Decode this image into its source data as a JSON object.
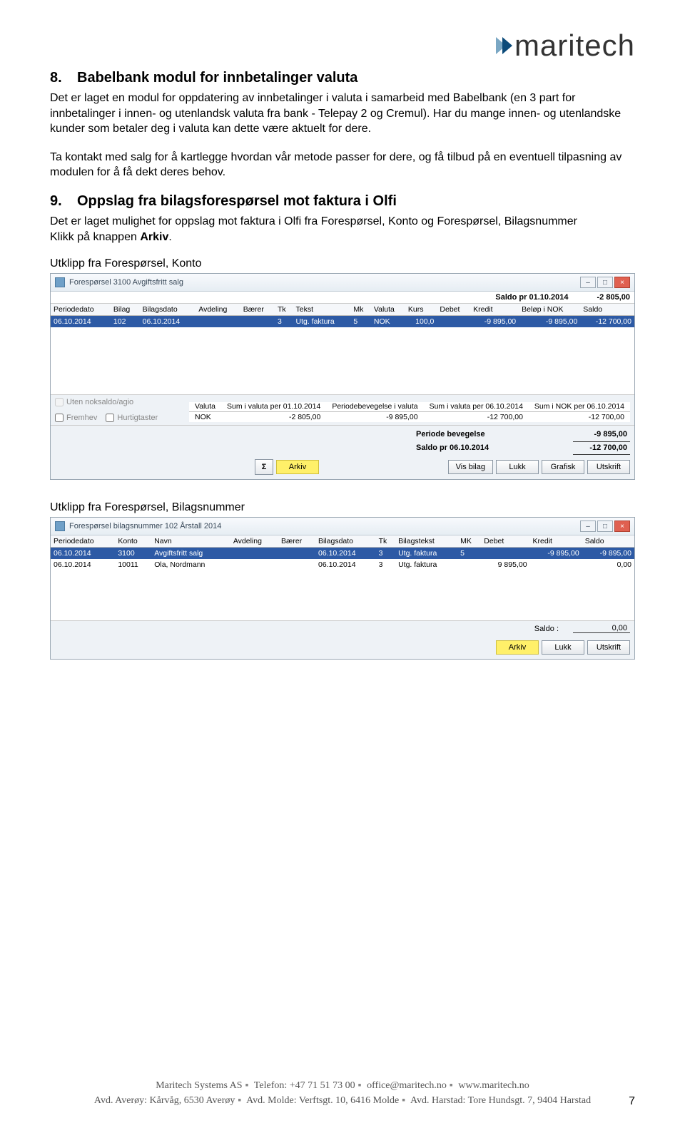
{
  "logo_text": "maritech",
  "section8": {
    "num": "8.",
    "title": "Babelbank modul for innbetalinger valuta",
    "p1": "Det er laget en modul for oppdatering av innbetalinger i valuta i samarbeid med Babelbank (en 3 part for innbetalinger i innen- og utenlandsk valuta fra bank - Telepay 2 og Cremul). Har du mange innen- og utenlandske kunder som betaler deg i valuta kan dette være aktuelt for dere.",
    "p2": "Ta kontakt med salg for å kartlegge hvordan vår metode passer for dere, og få tilbud på en eventuell tilpasning av modulen for å få dekt deres behov."
  },
  "section9": {
    "num": "9.",
    "title": "Oppslag fra bilagsforespørsel mot faktura i Olfi",
    "p1_a": "Det er laget mulighet for oppslag mot faktura i Olfi fra Forespørsel, Konto og Forespørsel, Bilagsnummer",
    "p1_b": "Klikk på knappen ",
    "p1_bold": "Arkiv",
    "p1_c": "."
  },
  "caption1": "Utklipp fra Forespørsel, Konto",
  "caption2": "Utklipp fra Forespørsel, Bilagsnummer",
  "win1": {
    "title": "Forespørsel 3100 Avgiftsfritt salg",
    "saldo_label": "Saldo pr 01.10.2014",
    "saldo_value": "-2 805,00",
    "headers": [
      "Periodedato",
      "Bilag",
      "Bilagsdato",
      "Avdeling",
      "Bærer",
      "Tk",
      "Tekst",
      "Mk",
      "Valuta",
      "Kurs",
      "Debet",
      "Kredit",
      "Beløp i NOK",
      "Saldo"
    ],
    "row": [
      "06.10.2014",
      "102",
      "06.10.2014",
      "",
      "",
      "3",
      "Utg. faktura",
      "5",
      "NOK",
      "100,0",
      "",
      "-9 895,00",
      "-9 895,00",
      "-12 700,00"
    ],
    "chk1": "Uten noksaldo/agio",
    "chk2": "Fremhev",
    "chk3": "Hurtigtaster",
    "mini_headers": [
      "Valuta",
      "Sum i valuta\nper 01.10.2014",
      "Periodebevegelse\ni valuta",
      "Sum i valuta\nper 06.10.2014",
      "Sum i NOK\nper 06.10.2014"
    ],
    "mini_row": [
      "NOK",
      "-2 805,00",
      "-9 895,00",
      "-12 700,00",
      "-12 700,00"
    ],
    "periode_label": "Periode bevegelse",
    "periode_value": "-9 895,00",
    "saldo2_label": "Saldo pr 06.10.2014",
    "saldo2_value": "-12 700,00",
    "sigma": "Σ",
    "btn_arkiv": "Arkiv",
    "btn_vis": "Vis bilag",
    "btn_lukk": "Lukk",
    "btn_grafisk": "Grafisk",
    "btn_utskrift": "Utskrift"
  },
  "win2": {
    "title": "Forespørsel bilagsnummer 102 Årstall 2014",
    "headers": [
      "Periodedato",
      "Konto",
      "Navn",
      "Avdeling",
      "Bærer",
      "Bilagsdato",
      "Tk",
      "Bilagstekst",
      "MK",
      "Debet",
      "Kredit",
      "Saldo"
    ],
    "rows": [
      [
        "06.10.2014",
        "3100",
        "Avgiftsfritt salg",
        "",
        "",
        "06.10.2014",
        "3",
        "Utg. faktura",
        "5",
        "",
        "-9 895,00",
        "-9 895,00"
      ],
      [
        "06.10.2014",
        "10011",
        "Ola, Nordmann",
        "",
        "",
        "06.10.2014",
        "3",
        "Utg. faktura",
        "",
        "9 895,00",
        "",
        "0,00"
      ]
    ],
    "saldo_label": "Saldo :",
    "saldo_value": "0,00",
    "btn_arkiv": "Arkiv",
    "btn_lukk": "Lukk",
    "btn_utskrift": "Utskrift"
  },
  "footer": {
    "company": "Maritech Systems AS",
    "tel_label": "Telefon:",
    "tel": "+47 71 51 73 00",
    "email": "office@maritech.no",
    "web": "www.maritech.no",
    "addr1": "Avd. Averøy: Kårvåg, 6530 Averøy",
    "addr2": "Avd. Molde: Verftsgt. 10, 6416 Molde",
    "addr3": "Avd. Harstad: Tore Hundsgt. 7, 9404 Harstad"
  },
  "page_num": "7"
}
